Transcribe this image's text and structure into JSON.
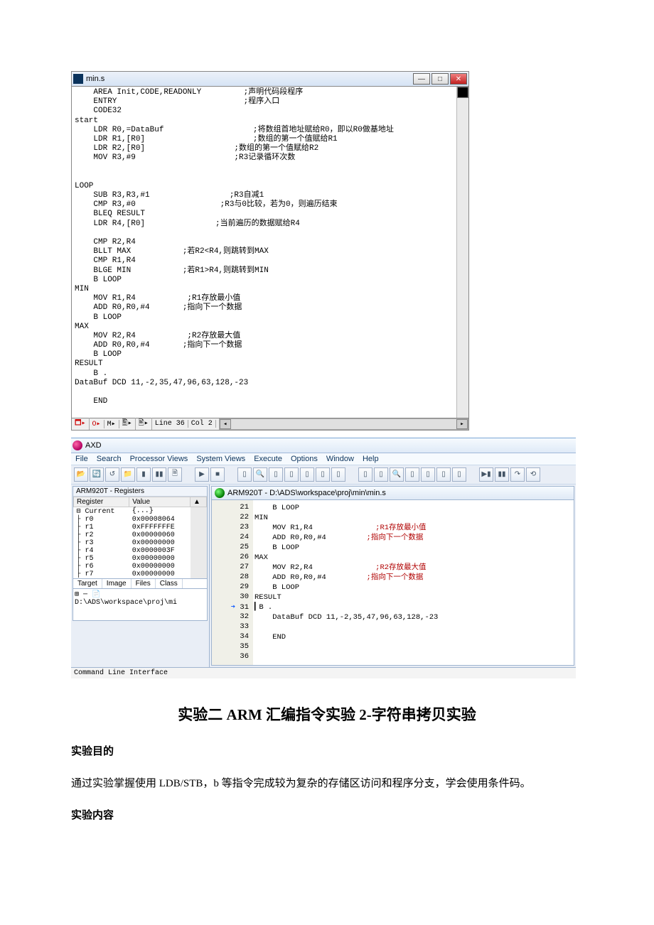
{
  "win1": {
    "title": "min.s",
    "code": "    AREA Init,CODE,READONLY         ;声明代码段程序\n    ENTRY                           ;程序入口\n    CODE32\nstart\n    LDR R0,=DataBuf                   ;将数组首地址赋给R0，即以R0做基地址\n    LDR R1,[R0]                       ;数组的第一个值赋给R1\n    LDR R2,[R0]                   ;数组的第一个值赋给R2\n    MOV R3,#9                     ;R3记录循环次数\n\n\nLOOP\n    SUB R3,R3,#1                 ;R3自减1\n    CMP R3,#0                  ;R3与0比较，若为0，则遍历结束\n    BLEQ RESULT\n    LDR R4,[R0]               ;当前遍历的数据赋给R4\n\n    CMP R2,R4\n    BLLT MAX           ;若R2<R4,则跳转到MAX\n    CMP R1,R4\n    BLGE MIN           ;若R1>R4,则跳转到MIN\n    B LOOP\nMIN\n    MOV R1,R4           ;R1存放最小值\n    ADD R0,R0,#4       ;指向下一个数据\n    B LOOP\nMAX\n    MOV R2,R4           ;R2存放最大值\n    ADD R0,R0,#4       ;指向下一个数据\n    B LOOP\nRESULT\n    B .\nDataBuf DCD 11,-2,35,47,96,63,128,-23\n\n    END\n\n",
    "status": {
      "line": "Line 36",
      "col": "Col 2"
    }
  },
  "win2": {
    "title": "AXD",
    "menus": [
      "File",
      "Search",
      "Processor Views",
      "System Views",
      "Execute",
      "Options",
      "Window",
      "Help"
    ],
    "regtitle": "ARM920T - Registers",
    "regheaders": [
      "Register",
      "Value"
    ],
    "regs": [
      {
        "name": "⊟ Current",
        "value": "{...}"
      },
      {
        "name": "  ├ r0",
        "value": "0x00008064"
      },
      {
        "name": "  ├ r1",
        "value": "0xFFFFFFFE"
      },
      {
        "name": "  ├ r2",
        "value": "0x00000060"
      },
      {
        "name": "  ├ r3",
        "value": "0x00000000"
      },
      {
        "name": "  ├ r4",
        "value": "0x0000003F"
      },
      {
        "name": "  ├ r5",
        "value": "0x00000000"
      },
      {
        "name": "  ├ r6",
        "value": "0x00000000"
      },
      {
        "name": "  ├ r7",
        "value": "0x00000000"
      }
    ],
    "tabs": [
      "Target",
      "Image",
      "Files",
      "Class"
    ],
    "tree": "⊞ ─ 📄 D:\\ADS\\workspace\\proj\\mi",
    "srctab": "ARM920T - D:\\ADS\\workspace\\proj\\min\\min.s",
    "src": {
      "start": 21,
      "arrowLine": 31,
      "lines": [
        "    B LOOP",
        "MIN",
        "    MOV R1,R4              ;R1存放最小值",
        "    ADD R0,R0,#4         ;指向下一个数据",
        "    B LOOP",
        "MAX",
        "    MOV R2,R4              ;R2存放最大值",
        "    ADD R0,R0,#4         ;指向下一个数据",
        "    B LOOP",
        "RESULT",
        "B .",
        "    DataBuf DCD 11,-2,35,47,96,63,128,-23",
        "",
        "    END",
        "",
        ""
      ]
    },
    "cli": "Command Line Interface"
  },
  "doc": {
    "title": "实验二  ARM 汇编指令实验 2-字符串拷贝实验",
    "h_purpose": "实验目的",
    "purpose": "通过实验掌握使用 LDB/STB，b 等指令完成较为复杂的存储区访问和程序分支，学会使用条件码。",
    "h_content": "实验内容"
  }
}
